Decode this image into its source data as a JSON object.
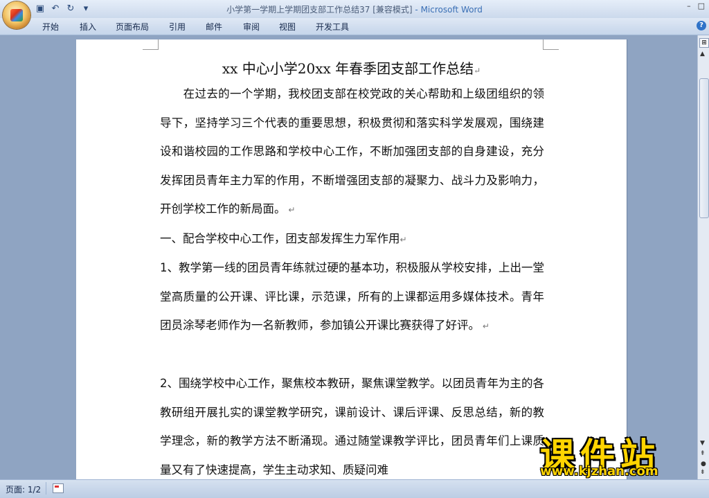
{
  "window": {
    "title": "小学第一学期上学期团支部工作总结37 [兼容模式]",
    "app_name": "- Microsoft Word",
    "controls": [
      "–",
      "□"
    ]
  },
  "quick_access": {
    "icons": [
      "save-icon",
      "undo-icon",
      "redo-icon",
      "customize-icon"
    ]
  },
  "ribbon": {
    "tabs": [
      "开始",
      "插入",
      "页面布局",
      "引用",
      "邮件",
      "审阅",
      "视图",
      "开发工具"
    ]
  },
  "document": {
    "title": "xx 中心小学20xx 年春季团支部工作总结",
    "paragraphs": [
      "　　在过去的一个学期，我校团支部在校党政的关心帮助和上级团组织的领导下，坚持学习三个代表的重要思想，积极贯彻和落实科学发展观，围绕建设和谐校园的工作思路和学校中心工作，不断加强团支部的自身建设，充分发挥团员青年主力军的作用，不断增强团支部的凝聚力、战斗力及影响力，开创学校工作的新局面。",
      "一、配合学校中心工作，团支部发挥生力军作用",
      "1、教学第一线的团员青年练就过硬的基本功，积极服从学校安排，上出一堂堂高质量的公开课、评比课，示范课，所有的上课都运用多媒体技术。青年团员涂琴老师作为一名新教师，参加镇公开课比赛获得了好评。",
      "2、围绕学校中心工作，聚焦校本教研，聚焦课堂教学。以团员青年为主的各教研组开展扎实的课堂教学研究，课前设计、课后评课、反思总结，新的教学理念，新的教学方法不断涌现。通过随堂课教学评比，团员青年们上课质量又有了快速提高，学生主动求知、质疑问难"
    ]
  },
  "status_bar": {
    "page": "页面: 1/2"
  },
  "watermark": {
    "brand": "课件站",
    "url": "www.kjzhan.com"
  }
}
